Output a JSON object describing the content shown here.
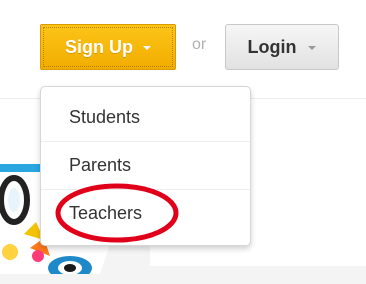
{
  "header": {
    "signup_label": "Sign Up",
    "or_label": "or",
    "login_label": "Login"
  },
  "signup_menu": {
    "items": [
      {
        "label": "Students"
      },
      {
        "label": "Parents"
      },
      {
        "label": "Teachers"
      }
    ]
  },
  "colors": {
    "signup_button": "#f6b400",
    "highlight_circle": "#e1001a"
  },
  "icons": {
    "signup_caret": "chevron-down-icon",
    "login_caret": "chevron-down-icon"
  }
}
